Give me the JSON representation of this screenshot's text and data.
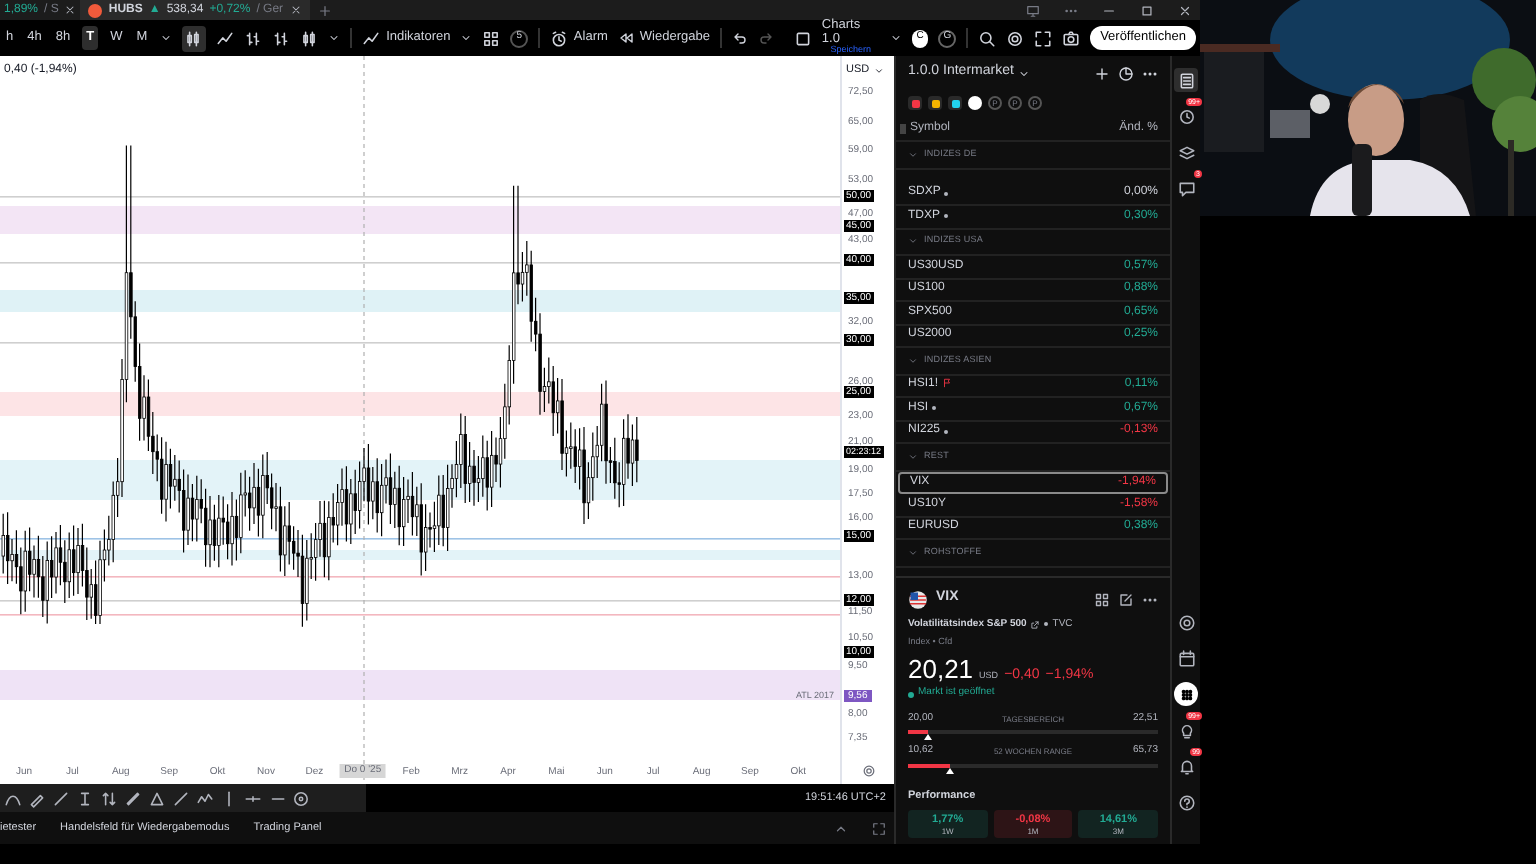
{
  "tabs": [
    {
      "kind": "partial",
      "change": "1,89%",
      "rest": "/ S",
      "selected": false
    },
    {
      "kind": "symbol",
      "symbol": "HUBS",
      "arrow": "▲",
      "price": "538,34",
      "change": "+0,72%",
      "rest": "/ Ger",
      "selected": true
    }
  ],
  "toolbar": {
    "intervals": [
      {
        "label": "h",
        "selected": false
      },
      {
        "label": "4h",
        "selected": false
      },
      {
        "label": "8h",
        "selected": false
      },
      {
        "label": "T",
        "selected": true
      },
      {
        "label": "W",
        "selected": false
      },
      {
        "label": "M",
        "selected": false
      }
    ],
    "indicators": "Indikatoren",
    "templates_count": "5",
    "alarm": "Alarm",
    "replay": "Wiedergabe",
    "layout_name": "Charts 1.0",
    "layout_status": "Speichern",
    "users": [
      {
        "letter": "C",
        "selected": true
      },
      {
        "letter": "G",
        "selected": false
      }
    ],
    "publish": "Veröffentlichen"
  },
  "chart": {
    "header": "0,40 (-1,94%)",
    "currency": "USD",
    "y_labels": [
      {
        "text": "72,50",
        "kind": "tick"
      },
      {
        "text": "65,00",
        "kind": "tick"
      },
      {
        "text": "59,00",
        "kind": "tick"
      },
      {
        "text": "53,00",
        "kind": "tick"
      },
      {
        "text": "50,00",
        "kind": "level"
      },
      {
        "text": "47,00",
        "kind": "tick"
      },
      {
        "text": "45,00",
        "kind": "level"
      },
      {
        "text": "43,00",
        "kind": "tick"
      },
      {
        "text": "40,00",
        "kind": "level"
      },
      {
        "text": "35,00",
        "kind": "level"
      },
      {
        "text": "32,00",
        "kind": "tick"
      },
      {
        "text": "30,00",
        "kind": "level"
      },
      {
        "text": "26,00",
        "kind": "tick"
      },
      {
        "text": "25,00",
        "kind": "level"
      },
      {
        "text": "23,00",
        "kind": "tick"
      },
      {
        "text": "21,00",
        "kind": "tick"
      },
      {
        "text": "02:23:12",
        "kind": "price"
      },
      {
        "text": "19,00",
        "kind": "tick"
      },
      {
        "text": "17,50",
        "kind": "tick"
      },
      {
        "text": "16,00",
        "kind": "tick"
      },
      {
        "text": "15,00",
        "kind": "level"
      },
      {
        "text": "13,00",
        "kind": "tick"
      },
      {
        "text": "12,00",
        "kind": "level"
      },
      {
        "text": "11,50",
        "kind": "tick"
      },
      {
        "text": "10,50",
        "kind": "tick"
      },
      {
        "text": "10,00",
        "kind": "level"
      },
      {
        "text": "9,50",
        "kind": "tick"
      },
      {
        "text": "9,56",
        "kind": "alert"
      },
      {
        "text": "8,00",
        "kind": "tick"
      },
      {
        "text": "7,35",
        "kind": "tick"
      }
    ],
    "annotation": "ATL 2017",
    "x_labels": [
      {
        "text": "Jun",
        "kind": "tick"
      },
      {
        "text": "Jul",
        "kind": "tick"
      },
      {
        "text": "Aug",
        "kind": "tick"
      },
      {
        "text": "Sep",
        "kind": "tick"
      },
      {
        "text": "Okt",
        "kind": "tick"
      },
      {
        "text": "Nov",
        "kind": "tick"
      },
      {
        "text": "Dez",
        "kind": "tick"
      },
      {
        "text": "Do 0 '25",
        "kind": "crosshair"
      },
      {
        "text": "Feb",
        "kind": "tick"
      },
      {
        "text": "Mrz",
        "kind": "tick"
      },
      {
        "text": "Apr",
        "kind": "tick"
      },
      {
        "text": "Mai",
        "kind": "tick"
      },
      {
        "text": "Jun",
        "kind": "tick"
      },
      {
        "text": "Jul",
        "kind": "tick"
      },
      {
        "text": "Aug",
        "kind": "tick"
      },
      {
        "text": "Sep",
        "kind": "tick"
      },
      {
        "text": "Okt",
        "kind": "tick"
      }
    ],
    "time": "19:51:46 UTC+2"
  },
  "bottom_tabs": [
    "ietester",
    "Handelsfeld für Wiedergabemodus",
    "Trading Panel"
  ],
  "watchlist": {
    "title": "1.0.0 Intermarket",
    "flags": [
      {
        "color": "#f23645"
      },
      {
        "color": "#f5b400"
      },
      {
        "color": "#22d3ee"
      }
    ],
    "lists": [
      {
        "selected": true
      },
      {
        "label": "P",
        "selected": false
      },
      {
        "label": "P",
        "selected": false
      },
      {
        "label": "P",
        "selected": false
      }
    ],
    "columns": [
      "Symbol",
      "Änd. %"
    ],
    "sections": [
      {
        "title": "INDIZES DE",
        "expanded": true,
        "rows": [
          {
            "symbol": "SDXP",
            "dotted": true,
            "change": "0,00%",
            "color": "#d1d4dc",
            "selected": false
          },
          {
            "symbol": "TDXP",
            "dotted": true,
            "change": "0,30%",
            "color": "#22ab94",
            "selected": false
          }
        ]
      },
      {
        "title": "INDIZES USA",
        "expanded": true,
        "rows": [
          {
            "symbol": "US30USD",
            "change": "0,57%",
            "color": "#22ab94",
            "selected": false
          },
          {
            "symbol": "US100",
            "change": "0,88%",
            "color": "#22ab94",
            "selected": false
          },
          {
            "symbol": "SPX500",
            "change": "0,65%",
            "color": "#22ab94",
            "selected": false
          },
          {
            "symbol": "US2000",
            "change": "0,25%",
            "color": "#22ab94",
            "selected": false
          }
        ]
      },
      {
        "title": "INDIZES ASIEN",
        "expanded": true,
        "rows": [
          {
            "symbol": "HSI1!",
            "flagged": true,
            "change": "0,11%",
            "color": "#22ab94",
            "selected": false
          },
          {
            "symbol": "HSI",
            "dotted": true,
            "change": "0,67%",
            "color": "#22ab94",
            "selected": false
          },
          {
            "symbol": "NI225",
            "dotted": true,
            "change": "-0,13%",
            "color": "#f23645",
            "selected": false
          }
        ]
      },
      {
        "title": "REST",
        "expanded": true,
        "rows": [
          {
            "symbol": "VIX",
            "change": "-1,94%",
            "color": "#f23645",
            "selected": true
          },
          {
            "symbol": "US10Y",
            "change": "-1,58%",
            "color": "#f23645",
            "selected": false
          },
          {
            "symbol": "EURUSD",
            "change": "0,38%",
            "color": "#22ab94",
            "selected": false
          }
        ]
      },
      {
        "title": "ROHSTOFFE",
        "expanded": true
      }
    ]
  },
  "details": {
    "symbol": "VIX",
    "name": "Volatilitätsindex S&P 500",
    "source": "TVC",
    "type": "Index • Cfd",
    "price": "20,21",
    "currency": "USD",
    "change": "−0,40",
    "change_pct": "−1,94%",
    "color": "#f23645",
    "market_status": "Markt ist geöffnet",
    "ranges": [
      {
        "low": "20,00",
        "label": "TAGESBEREICH",
        "high": "22,51",
        "level": 0.08
      },
      {
        "low": "10,62",
        "label": "52 WOCHEN RANGE",
        "high": "65,73",
        "level": 0.17
      }
    ],
    "performance_title": "Performance",
    "performance": [
      {
        "value": "1,77%",
        "period": "1W",
        "color": "#22ab94"
      },
      {
        "value": "-0,08%",
        "period": "1M",
        "color": "#f23645"
      },
      {
        "value": "14,61%",
        "period": "3M",
        "color": "#22ab94"
      }
    ]
  },
  "side_icons": {
    "top": [
      {
        "kind": "watchlist",
        "selected": true
      },
      {
        "kind": "alerts",
        "badge": "99+",
        "selected": false
      },
      {
        "kind": "layers",
        "selected": false
      },
      {
        "kind": "chat",
        "badge": "3",
        "selected": false
      }
    ],
    "bottom": [
      {
        "kind": "target",
        "selected": false
      },
      {
        "kind": "calendar",
        "selected": false
      },
      {
        "kind": "apps",
        "selected": true
      },
      {
        "kind": "ideas",
        "badge": "99+",
        "selected": false
      },
      {
        "kind": "bell",
        "badge": "99",
        "selected": false
      },
      {
        "kind": "help",
        "selected": false
      }
    ]
  },
  "webcam": {
    "kind": "picture"
  }
}
